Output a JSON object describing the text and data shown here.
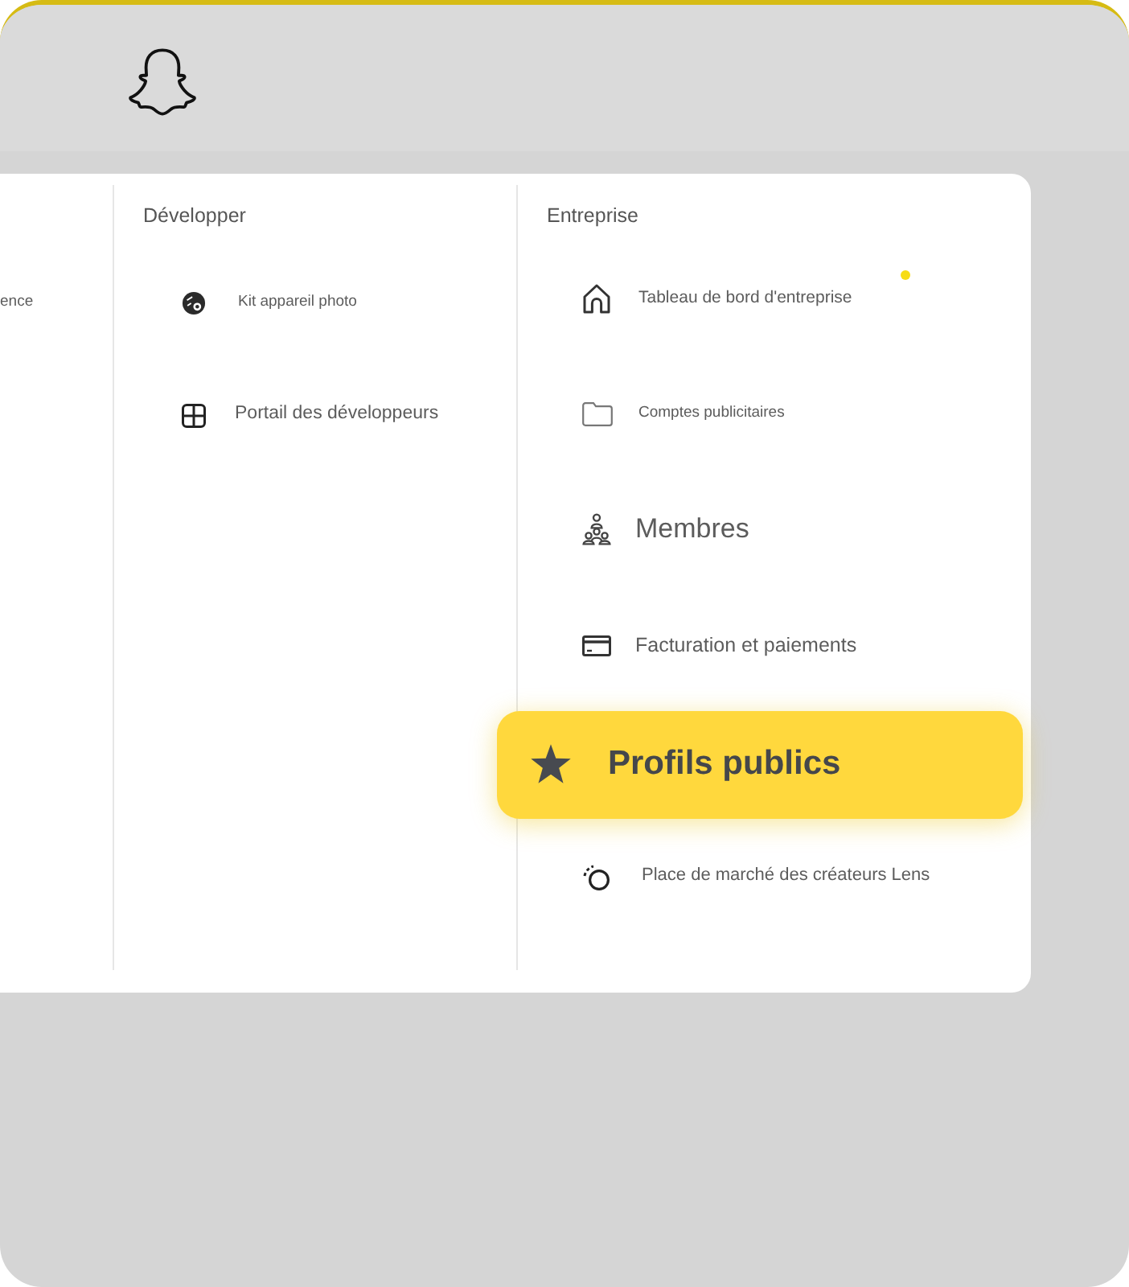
{
  "menu": {
    "columns": [
      {
        "items": [
          {
            "label": "ence",
            "selected": false
          }
        ]
      },
      {
        "title": "Développer",
        "items": [
          {
            "label": "Kit appareil photo",
            "selected": false
          },
          {
            "label": "Portail des développeurs",
            "selected": false
          }
        ]
      },
      {
        "title": "Entreprise",
        "items": [
          {
            "label": "Tableau de bord d'entreprise",
            "selected": false,
            "notification": true
          },
          {
            "label": "Comptes publicitaires",
            "selected": false,
            "notification": false
          },
          {
            "label": "Membres",
            "selected": false,
            "notification": false
          },
          {
            "label": "Facturation et paiements",
            "selected": false,
            "notification": false
          },
          {
            "label": "Profils publics",
            "selected": true,
            "notification": false
          },
          {
            "label": "Place de marché des créateurs Lens",
            "selected": false,
            "notification": false
          }
        ]
      }
    ]
  }
}
